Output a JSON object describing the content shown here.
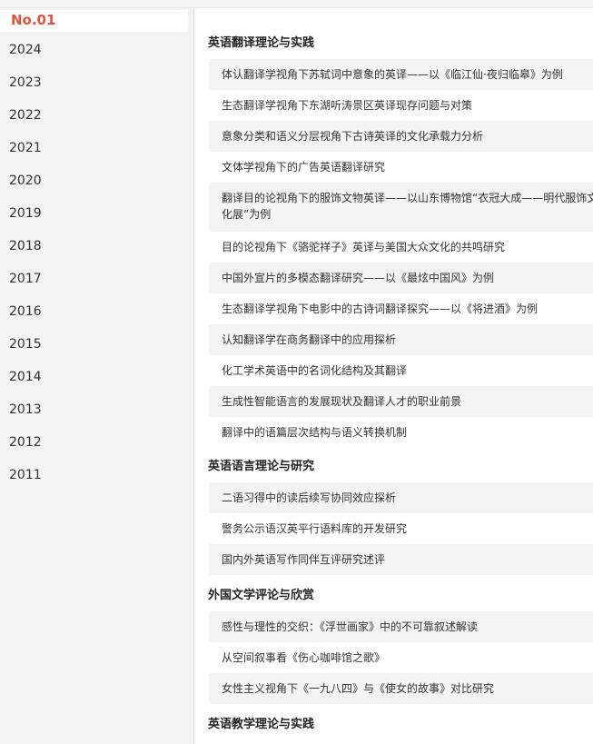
{
  "sidebar": {
    "issue": "No.01",
    "years": [
      "2024",
      "2023",
      "2022",
      "2021",
      "2020",
      "2019",
      "2018",
      "2017",
      "2016",
      "2015",
      "2014",
      "2013",
      "2012",
      "2011"
    ]
  },
  "sections": [
    {
      "title": "英语翻译理论与实践",
      "articles": [
        "体认翻译学视角下苏轼词中意象的英译——以《临江仙·夜归临皋》为例",
        "生态翻译学视角下东湖听涛景区英译现存问题与对策",
        "意象分类和语义分层视角下古诗英译的文化承载力分析",
        "文体学视角下的广告英语翻译研究",
        "翻译目的论视角下的服饰文物英译——以山东博物馆“衣冠大成——明代服饰文化展”为例",
        "目的论视角下《骆驼祥子》英译与美国大众文化的共鸣研究",
        "中国外宣片的多模态翻译研究——以《最炫中国风》为例",
        "生态翻译学视角下电影中的古诗词翻译探究——以《将进酒》为例",
        "认知翻译学在商务翻译中的应用探析",
        "化工学术英语中的名词化结构及其翻译",
        "生成性智能语言的发展现状及翻译人才的职业前景",
        "翻译中的语篇层次结构与语义转换机制"
      ]
    },
    {
      "title": "英语语言理论与研究",
      "articles": [
        "二语习得中的读后续写协同效应探析",
        "警务公示语汉英平行语料库的开发研究",
        "国内外英语写作同伴互评研究述评"
      ]
    },
    {
      "title": "外国文学评论与欣赏",
      "articles": [
        "感性与理性的交织：《浮世画家》中的不可靠叙述解读",
        "从空间叙事看《伤心咖啡馆之歌》",
        "女性主义视角下《一九八四》与《使女的故事》对比研究"
      ]
    },
    {
      "title": "英语教学理论与实践",
      "articles": []
    }
  ]
}
